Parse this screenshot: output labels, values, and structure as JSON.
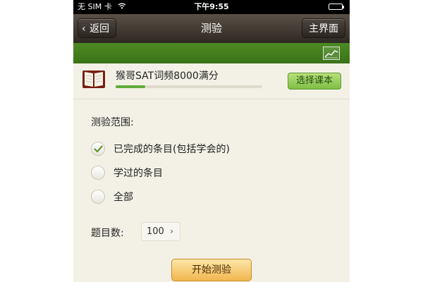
{
  "status_bar": {
    "carrier": "无 SIM 卡",
    "time": "下午9:55",
    "icons": [
      "wifi-icon",
      "battery-icon"
    ]
  },
  "nav": {
    "back_label": "返回",
    "title": "测验",
    "home_label": "主界面"
  },
  "toolbar": {
    "chart_icon": "chart-icon"
  },
  "book": {
    "title": "猴哥SAT词频8000满分",
    "progress": 0.2,
    "select_label": "选择课本"
  },
  "quiz": {
    "range_label": "测验范围:",
    "options": [
      {
        "label": "已完成的条目(包括学会的)",
        "selected": true
      },
      {
        "label": "学过的条目",
        "selected": false
      },
      {
        "label": "全部",
        "selected": false
      }
    ],
    "count_label": "题目数:",
    "count_value": "100",
    "start_label": "开始测验"
  },
  "colors": {
    "nav_bg": "#2f2922",
    "green_bar": "#3a7218",
    "select_button": "#7fbf45",
    "start_button": "#f1b64f",
    "check": "#5c9b2e"
  }
}
